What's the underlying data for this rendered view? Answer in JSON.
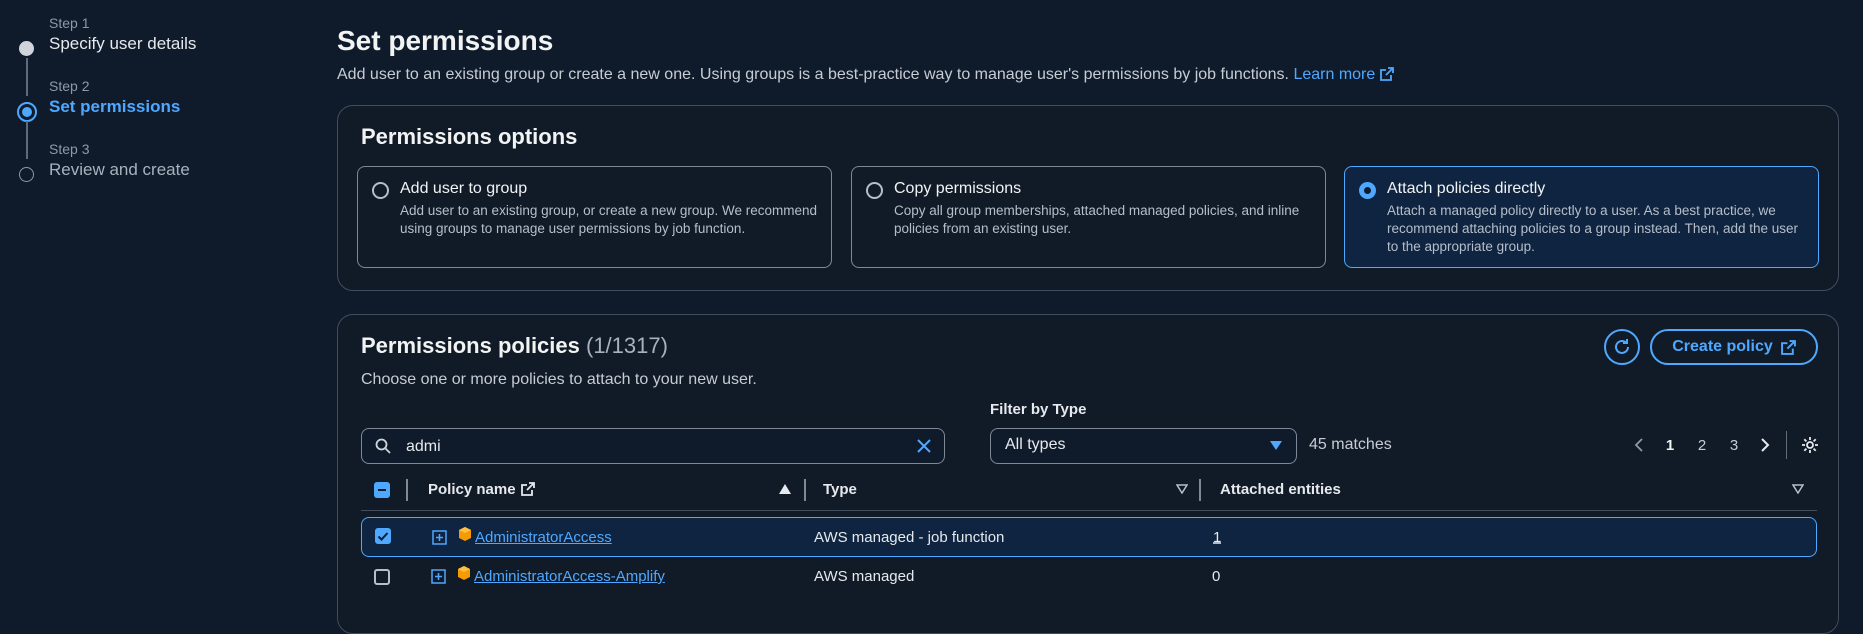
{
  "stepper": {
    "steps": [
      {
        "num": "Step 1",
        "name": "Specify user details",
        "state": "done"
      },
      {
        "num": "Step 2",
        "name": "Set permissions",
        "state": "active"
      },
      {
        "num": "Step 3",
        "name": "Review and create",
        "state": "pending"
      }
    ]
  },
  "header": {
    "title": "Set permissions",
    "description": "Add user to an existing group or create a new one. Using groups is a best-practice way to manage user's permissions by job functions.",
    "learn_more": "Learn more"
  },
  "options": {
    "title": "Permissions options",
    "items": [
      {
        "title": "Add user to group",
        "desc": "Add user to an existing group, or create a new group. We recommend using groups to manage user permissions by job function.",
        "selected": false
      },
      {
        "title": "Copy permissions",
        "desc": "Copy all group memberships, attached managed policies, and inline policies from an existing user.",
        "selected": false
      },
      {
        "title": "Attach policies directly",
        "desc": "Attach a managed policy directly to a user. As a best practice, we recommend attaching policies to a group instead. Then, add the user to the appropriate group.",
        "selected": true
      }
    ]
  },
  "policies": {
    "title": "Permissions policies",
    "count": "(1/1317)",
    "description": "Choose one or more policies to attach to your new user.",
    "refresh_icon": "refresh-icon",
    "create_label": "Create policy",
    "search_value": "admi",
    "filter_label": "Filter by Type",
    "filter_value": "All types",
    "matches": "45 matches",
    "pages": [
      "1",
      "2",
      "3"
    ],
    "current_page": "1",
    "columns": {
      "name": "Policy name",
      "type": "Type",
      "entities": "Attached entities"
    },
    "rows": [
      {
        "name": "AdministratorAccess",
        "type": "AWS managed - job function",
        "entities": "1",
        "checked": true
      },
      {
        "name": "AdministratorAccess-Amplify",
        "type": "AWS managed",
        "entities": "0",
        "checked": false
      }
    ]
  },
  "colors": {
    "accent": "#4fa8ff",
    "background": "#0f1b2a",
    "aws_orange": "#f59a00"
  }
}
